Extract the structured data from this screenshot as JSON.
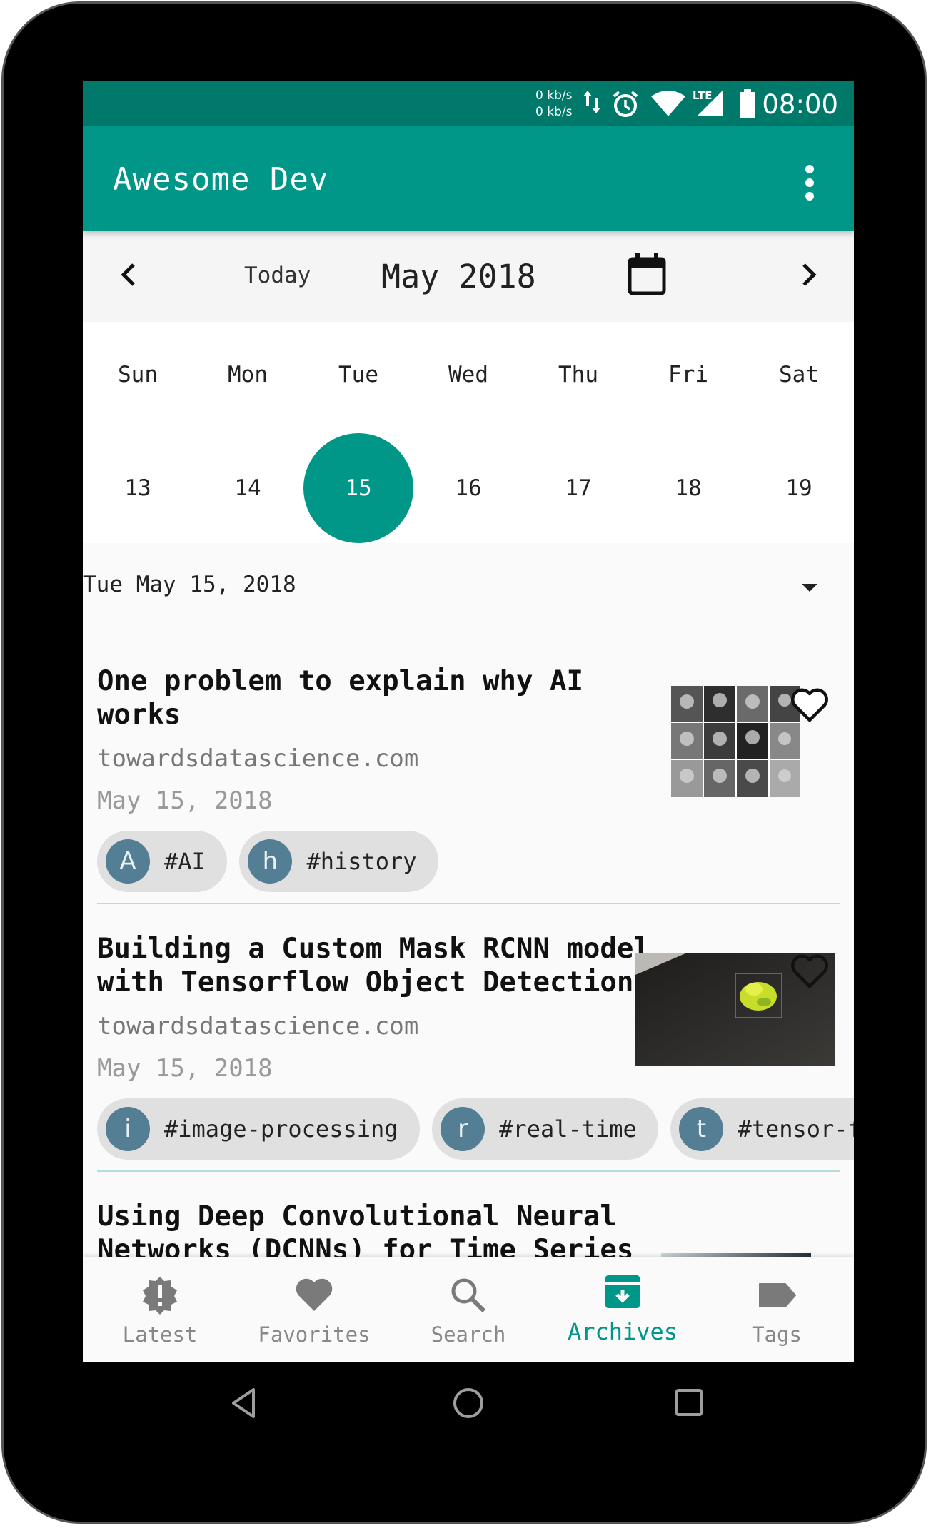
{
  "statusbar": {
    "net_up": "0 kb/s",
    "net_down": "0 kb/s",
    "signal_label": "LTE",
    "time": "08:00"
  },
  "appbar": {
    "title": "Awesome Dev"
  },
  "calendar": {
    "today_label": "Today",
    "month_label": "May 2018",
    "weekdays": [
      "Sun",
      "Mon",
      "Tue",
      "Wed",
      "Thu",
      "Fri",
      "Sat"
    ],
    "days": [
      "13",
      "14",
      "15",
      "16",
      "17",
      "18",
      "19"
    ],
    "selected_day": "15"
  },
  "selected_date": "Tue May 15, 2018",
  "articles": [
    {
      "title_line1": "One problem to explain why AI",
      "title_line2": "works",
      "source": "towardsdatascience.com",
      "date": "May 15, 2018",
      "tags": [
        {
          "initial": "A",
          "label": "#AI"
        },
        {
          "initial": "h",
          "label": "#history"
        }
      ]
    },
    {
      "title_line1": "Building a Custom Mask RCNN model",
      "title_line2": "with Tensorflow Object Detection",
      "source": "towardsdatascience.com",
      "date": "May 15, 2018",
      "tags": [
        {
          "initial": "i",
          "label": "#image-processing"
        },
        {
          "initial": "r",
          "label": "#real-time"
        },
        {
          "initial": "t",
          "label": "#tensor-flo"
        }
      ]
    },
    {
      "title_line1": "Using Deep Convolutional Neural",
      "title_line2": "Networks (DCNNs) for Time Series"
    }
  ],
  "bottom_nav": [
    {
      "label": "Latest",
      "icon": "alert-badge-icon"
    },
    {
      "label": "Favorites",
      "icon": "heart-icon"
    },
    {
      "label": "Search",
      "icon": "search-icon"
    },
    {
      "label": "Archives",
      "icon": "archive-icon",
      "active": true
    },
    {
      "label": "Tags",
      "icon": "tag-icon"
    }
  ],
  "colors": {
    "primary": "#009688",
    "primary_dark": "#00796b",
    "chip_avatar": "#547e94"
  }
}
